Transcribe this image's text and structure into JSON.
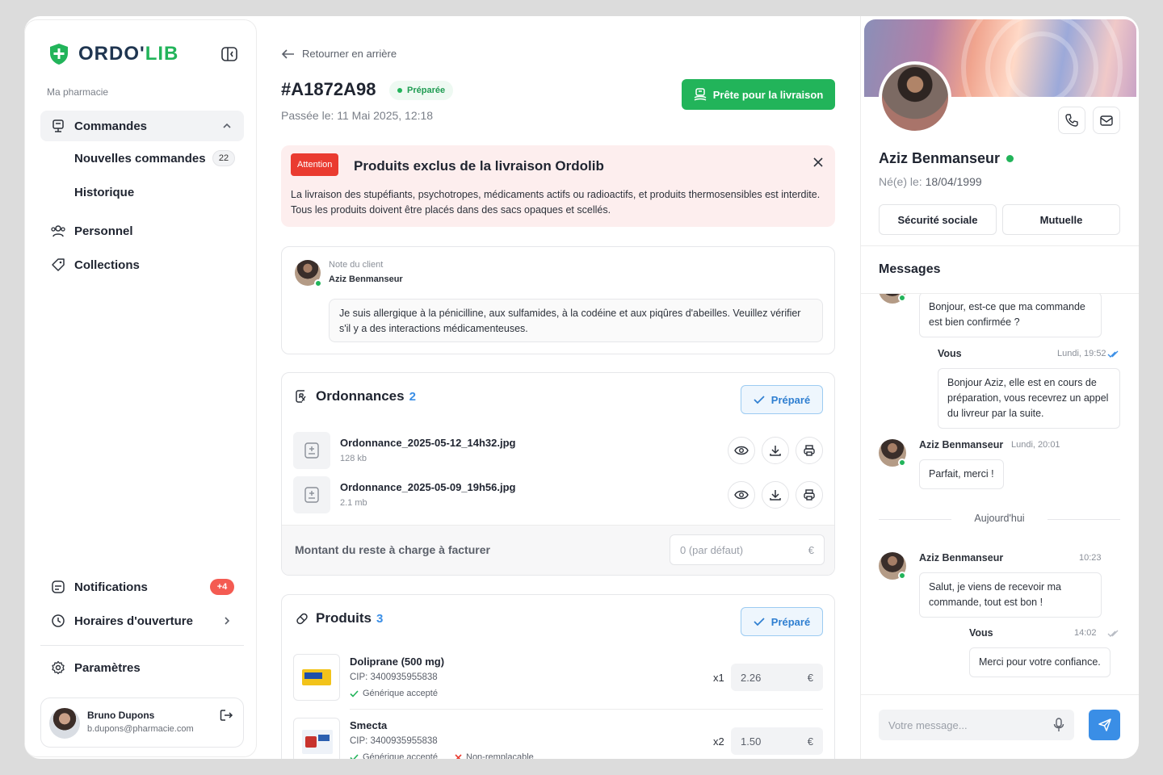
{
  "app": {
    "logo_text_a": "ORDO'",
    "logo_text_b": "LIB",
    "section_label": "Ma pharmacie"
  },
  "sidebar": {
    "orders_label": "Commandes",
    "new_orders_label": "Nouvelles commandes",
    "new_orders_count": "22",
    "history_label": "Historique",
    "staff_label": "Personnel",
    "collections_label": "Collections",
    "notifications_label": "Notifications",
    "notifications_badge": "+4",
    "hours_label": "Horaires d'ouverture",
    "settings_label": "Paramètres",
    "user": {
      "name": "Bruno Dupons",
      "email": "b.dupons@pharmacie.com"
    }
  },
  "order": {
    "back_label": "Retourner en arrière",
    "id": "#A1872A98",
    "status": "Préparée",
    "date": "Passée le: 11 Mai 2025, 12:18",
    "ready_button": "Prête pour la livraison"
  },
  "alert": {
    "tag": "Attention",
    "title": "Produits exclus de la livraison Ordolib",
    "body": "La livraison des stupéfiants, psychotropes, médicaments actifs ou radioactifs, et produits thermosensibles est interdite. Tous les produits doivent être placés dans des sacs opaques et scellés."
  },
  "note": {
    "label": "Note du client",
    "author": "Aziz Benmanseur",
    "text": "Je suis allergique à la pénicilline, aux sulfamides, à la codéine et aux piqûres d'abeilles. Veuillez vérifier s'il y a des interactions médicamenteuses."
  },
  "prescriptions": {
    "title": "Ordonnances",
    "count": "2",
    "prepared_label": "Préparé",
    "files": [
      {
        "name": "Ordonnance_2025-05-12_14h32.jpg",
        "size": "128 kb"
      },
      {
        "name": "Ordonnance_2025-05-09_19h56.jpg",
        "size": "2.1 mb"
      }
    ],
    "amount_label": "Montant du reste à charge à facturer",
    "amount_placeholder": "0 (par défaut)",
    "currency": "€"
  },
  "products": {
    "title": "Produits",
    "count": "3",
    "prepared_label": "Préparé",
    "items": [
      {
        "name": "Doliprane (500 mg)",
        "cip": "CIP: 3400935955838",
        "generic": "Générique accepté",
        "qty": "x1",
        "price": "2.26"
      },
      {
        "name": "Smecta",
        "cip": "CIP: 3400935955838",
        "generic": "Générique accepté",
        "non_replaceable": "Non-remplaçable",
        "qty": "x2",
        "price": "1.50"
      }
    ]
  },
  "patient": {
    "name": "Aziz Benmanseur",
    "dob_label": "Né(e) le:",
    "dob": "18/04/1999",
    "social_security": "Sécurité sociale",
    "mutual": "Mutuelle"
  },
  "messages": {
    "title": "Messages",
    "m1": "Bonjour, est-ce que ma commande est bien confirmée ?",
    "m2_author": "Vous",
    "m2_time": "Lundi, 19:52",
    "m2": "Bonjour Aziz, elle est en cours de préparation, vous recevrez un appel du livreur par la suite.",
    "m3_author": "Aziz Benmanseur",
    "m3_time": "Lundi, 20:01",
    "m3": "Parfait, merci !",
    "day": "Aujourd'hui",
    "m4_author": "Aziz Benmanseur",
    "m4_time": "10:23",
    "m4": "Salut, je viens de recevoir ma commande, tout est bon !",
    "m5_author": "Vous",
    "m5_time": "14:02",
    "m5": "Merci pour votre confiance.",
    "compose_placeholder": "Votre message..."
  },
  "colors": {
    "accent_green": "#22b45a",
    "accent_blue": "#3a8ee6",
    "alert_red": "#ea3b30"
  }
}
